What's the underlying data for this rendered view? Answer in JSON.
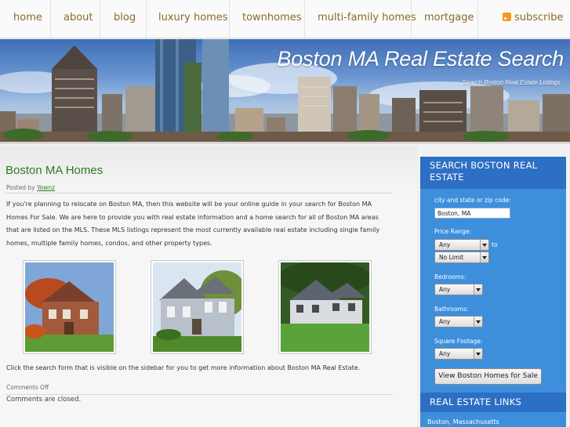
{
  "nav": {
    "items": [
      {
        "label": "home"
      },
      {
        "label": "about"
      },
      {
        "label": "blog"
      },
      {
        "label": "luxury homes"
      },
      {
        "label": "townhomes"
      },
      {
        "label": "multi-family homes"
      },
      {
        "label": "mortgage"
      }
    ],
    "subscribe": "subscribe",
    "icon": "rss-icon"
  },
  "banner": {
    "title": "Boston MA Real Estate Search",
    "subtitle": "Search Boston Real Estate Listings"
  },
  "post": {
    "title": "Boston MA Homes",
    "posted_by_label": "Posted by",
    "author": "Yownz",
    "body": "If you're planning to relocate on Boston MA, then this website will be your online guide in your search for Boston MA Homes For Sale. We are here to provide you with real estate information and a home search for all of Boston MA areas that are listed on the MLS. These MLS listings represent the most currently available real estate including single family homes, multiple family homes, condos, and other property types.",
    "footer_text": "Click the search form that is visible on the sidebar for you to get more information about Boston MA Real Estate.",
    "comments_off": "Comments Off",
    "comments_closed": "Comments are closed."
  },
  "search": {
    "heading": "SEARCH BOSTON REAL ESTATE",
    "city_label": "city and state or zip code:",
    "city_value": "Boston, MA",
    "price_label": "Price Range:",
    "price_min": "Any",
    "price_to": "to",
    "price_max": "No Limit",
    "bedrooms_label": "Bedrooms:",
    "bedrooms": "Any",
    "bathrooms_label": "Bathrooms:",
    "bathrooms": "Any",
    "sqft_label": "Square Footage:",
    "sqft": "Any",
    "button": "View Boston Homes for Sale"
  },
  "links": {
    "heading": "REAL ESTATE LINKS",
    "first": "Boston, Massachusetts"
  },
  "colors": {
    "nav_text": "#8a6a2c",
    "post_title": "#2d7a1f",
    "sidebar_bg": "#3d8fdc",
    "sidebar_head": "#2d6fc4"
  }
}
